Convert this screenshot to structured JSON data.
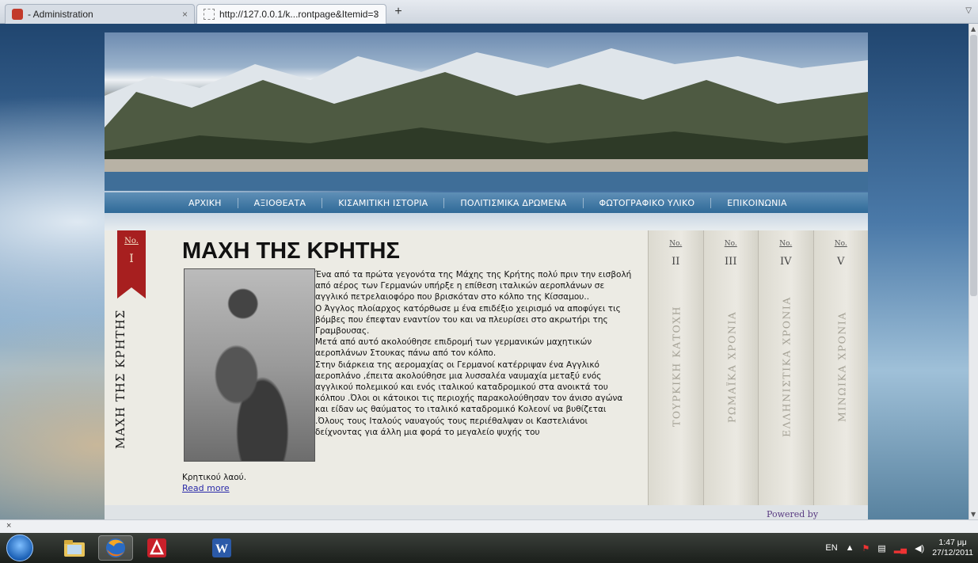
{
  "browser": {
    "tabs": [
      {
        "label": "- Administration"
      },
      {
        "label": "http://127.0.0.1/k...rontpage&Itemid=3"
      }
    ],
    "new_tab": "+",
    "close_tab": "×",
    "status_close": "×"
  },
  "site": {
    "nav": [
      "ΑΡΧΙΚΗ",
      "ΑΞΙΟΘΕΑΤΑ",
      "ΚΙΣΑΜΙΤΙΚΗ ΙΣΤΟΡΙΑ",
      "ΠΟΛΙΤΙΣΜΙΚΑ ΔΡΩΜΕΝΑ",
      "ΦΩΤΟΓΡΑΦΙΚΟ ΥΛΙΚΟ",
      "ΕΠΙΚΟΙΝΩΝΙΑ"
    ],
    "article": {
      "no_label": "No.",
      "number": "I",
      "side_title": "ΜΑΧΗ ΤΗΣ ΚΡΗΤΗΣ",
      "title": "ΜΑΧΗ ΤΗΣ ΚΡΗΤΗΣ",
      "paragraphs": [
        "Ένα από τα πρώτα γεγονότα της Μάχης της Κρήτης πολύ πριν την εισβολή από αέρος των Γερμανών υπήρξε η επίθεση ιταλικών αεροπλάνων σε αγγλικό πετρελαιοφόρο που βρισκόταν στο κόλπο της Κίσσαμου..",
        "Ο Άγγλος πλοίαρχος κατόρθωσε μ ένα επιδέξιο χειρισμό να αποφύγει τις βόμβες που έπεφταν εναντίον του και να πλευρίσει στο ακρωτήρι της Γραμβουσας.",
        "Μετά από αυτό ακολούθησε επιδρομή των γερμανικών μαχητικών αεροπλάνων Στουκας πάνω από τον κόλπο.",
        "Στην διάρκεια της αερομαχίας οι Γερμανοί κατέρριψαν ένα Αγγλικό αεροπλάνο ,έπειτα ακολούθησε μια λυσσαλέα ναυμαχία μεταξύ ενός αγγλικού πολεμικού και ενός ιταλικού καταδρομικού στα ανοικτά του κόλπου .Όλοι οι κάτοικοι τις περιοχής παρακολούθησαν τον άνισο αγώνα και είδαν ως θαύματος το ιταλικό καταδρομικό Κολεονί να βυθίζεται .Όλους τους Ιταλούς ναυαγούς τους περιέθαλψαν οι Καστελιάνοι δείχνοντας για άλλη μια φορά το μεγαλείο ψυχής του"
      ],
      "tail": "Κρητικού λαού.",
      "read_more": "Read more"
    },
    "side_tabs": [
      {
        "no": "No.",
        "num": "II",
        "label": "ΤΟΥΡΚΙΚΗ ΚΑΤΟΧΗ"
      },
      {
        "no": "No.",
        "num": "III",
        "label": "ΡΩΜΑΪΚΑ ΧΡΟΝΙΑ"
      },
      {
        "no": "No.",
        "num": "IV",
        "label": "ΕΛΛΗΝΙΣΤΙΚΑ ΧΡΟΝΙΑ"
      },
      {
        "no": "No.",
        "num": "V",
        "label": "ΜΙΝΩΙΚΑ ΧΡΟΝΙΑ"
      }
    ],
    "powered_by": "Powered by"
  },
  "taskbar": {
    "lang": "EN",
    "time": "1:47 μμ",
    "date": "27/12/2011",
    "apps": [
      "start-orb",
      "windows-explorer-icon",
      "firefox-icon",
      "pdf-reader-icon",
      "word-icon"
    ]
  },
  "colors": {
    "nav_bar": "#2f6a98",
    "ribbon": "#a71f1f",
    "content_bg": "#ecebe4",
    "link": "#2a2aa8"
  }
}
